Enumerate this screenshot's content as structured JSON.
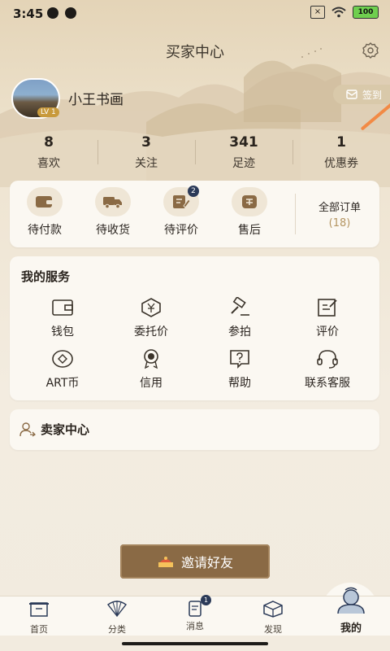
{
  "status": {
    "time": "3:45",
    "battery": "100"
  },
  "header": {
    "title": "买家中心"
  },
  "user": {
    "name": "小王书画",
    "level": "LV 1",
    "signin": "签到"
  },
  "stats": [
    {
      "num": "8",
      "label": "喜欢"
    },
    {
      "num": "3",
      "label": "关注"
    },
    {
      "num": "341",
      "label": "足迹"
    },
    {
      "num": "1",
      "label": "优惠券"
    }
  ],
  "orders": {
    "items": [
      {
        "label": "待付款",
        "icon": "wallet-icon"
      },
      {
        "label": "待收货",
        "icon": "truck-icon"
      },
      {
        "label": "待评价",
        "icon": "review-icon",
        "badge": "2"
      },
      {
        "label": "售后",
        "icon": "aftersale-icon"
      }
    ],
    "all_label": "全部订单",
    "all_count": "(18)"
  },
  "services": {
    "title": "我的服务",
    "items": [
      {
        "label": "钱包",
        "icon": "wallet-icon"
      },
      {
        "label": "委托价",
        "icon": "yuan-hexagon-icon"
      },
      {
        "label": "参拍",
        "icon": "gavel-icon"
      },
      {
        "label": "评价",
        "icon": "edit-note-icon"
      },
      {
        "label": "ART币",
        "icon": "coin-icon"
      },
      {
        "label": "信用",
        "icon": "badge-icon"
      },
      {
        "label": "帮助",
        "icon": "help-icon"
      },
      {
        "label": "联系客服",
        "icon": "headset-icon"
      }
    ]
  },
  "seller": {
    "label": "卖家中心"
  },
  "invite": {
    "label": "邀请好友"
  },
  "tabs": [
    {
      "label": "首页",
      "icon": "home-icon"
    },
    {
      "label": "分类",
      "icon": "fan-icon"
    },
    {
      "label": "消息",
      "icon": "scroll-icon",
      "badge": "1"
    },
    {
      "label": "发现",
      "icon": "box-icon"
    },
    {
      "label": "我的",
      "icon": "monk-icon"
    }
  ],
  "colors": {
    "accent": "#8a6a45",
    "badge": "#2b3a58",
    "bg": "#f2ebdf"
  }
}
